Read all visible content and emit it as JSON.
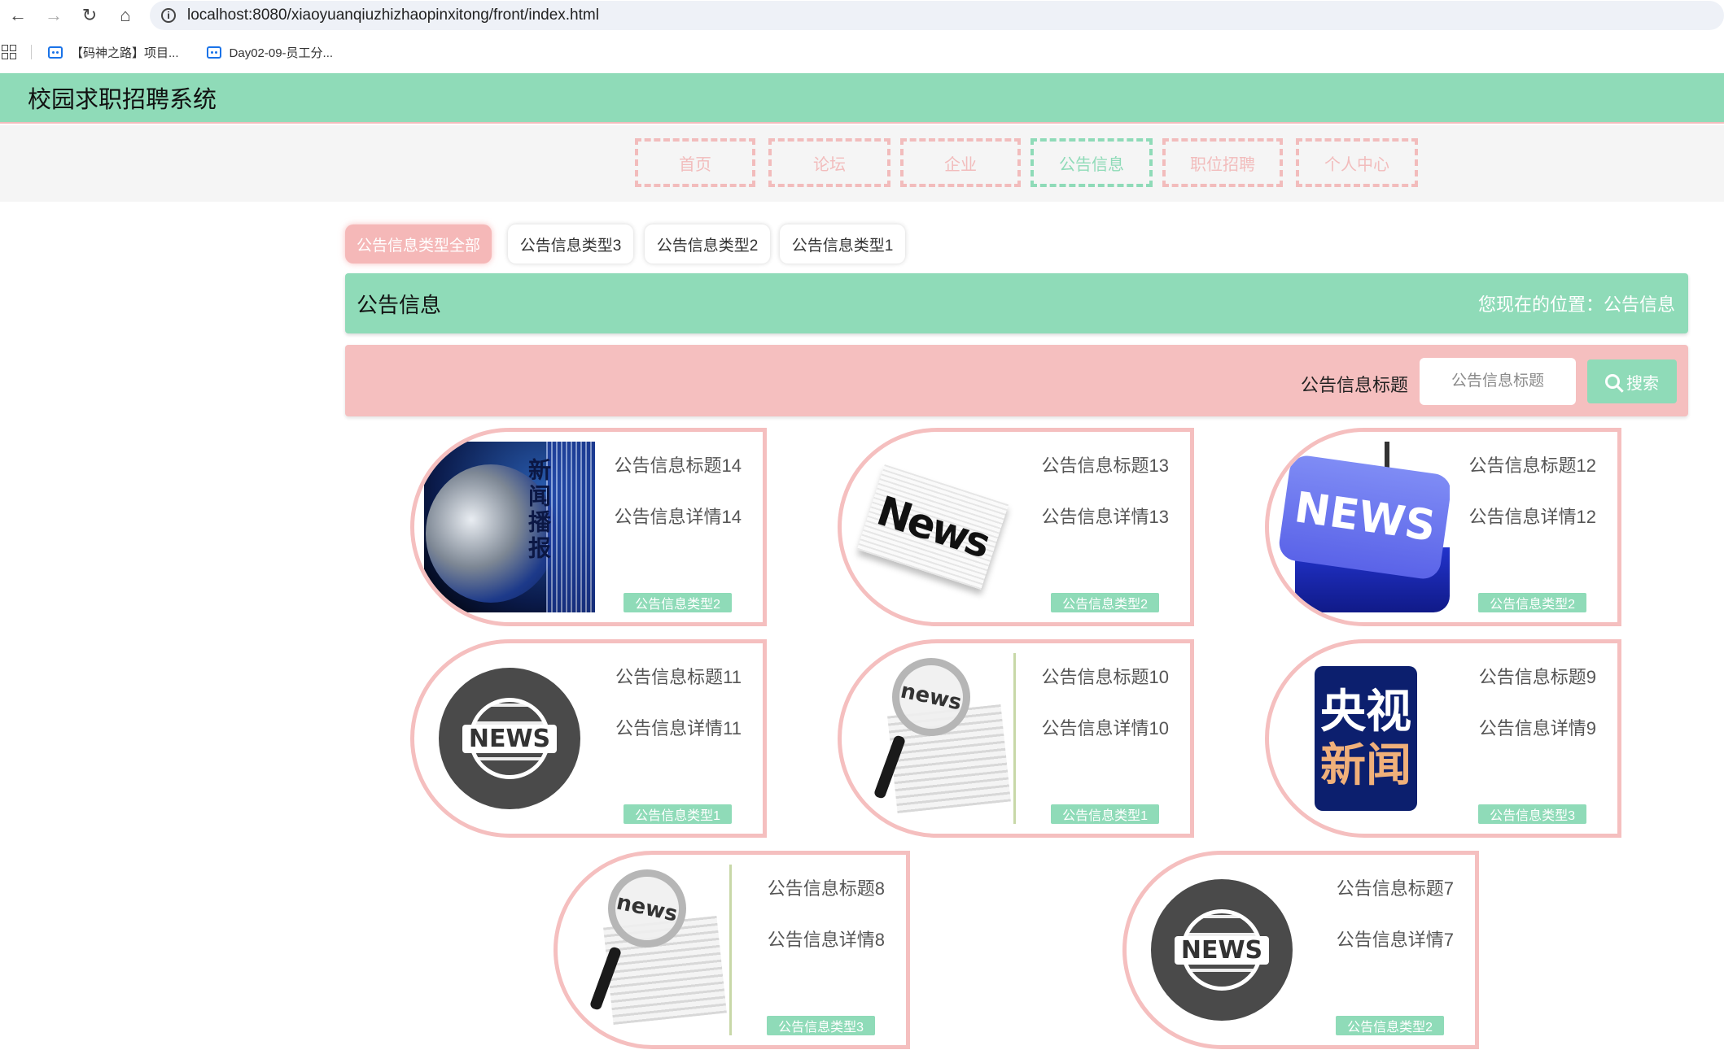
{
  "browser": {
    "url": "localhost:8080/xiaoyuanqiuzhizhaopinxitong/front/index.html",
    "bookmarks": [
      "【码神之路】项目...",
      "Day02-09-员工分..."
    ]
  },
  "app": {
    "title": "校园求职招聘系统"
  },
  "nav": {
    "items": [
      {
        "label": "首页"
      },
      {
        "label": "论坛"
      },
      {
        "label": "企业"
      },
      {
        "label": "公告信息"
      },
      {
        "label": "职位招聘"
      },
      {
        "label": "个人中心"
      }
    ],
    "active": "公告信息"
  },
  "types": {
    "items": [
      {
        "label": "公告信息类型全部"
      },
      {
        "label": "公告信息类型3"
      },
      {
        "label": "公告信息类型2"
      },
      {
        "label": "公告信息类型1"
      }
    ],
    "active": "公告信息类型全部"
  },
  "section": {
    "title": "公告信息",
    "breadcrumb": "您现在的位置：公告信息"
  },
  "search": {
    "label": "公告信息标题",
    "placeholder": "公告信息标题",
    "button": "搜索"
  },
  "cards": [
    {
      "title": "公告信息标题14",
      "detail": "公告信息详情14",
      "type": "公告信息类型2",
      "thumb": "globe-news"
    },
    {
      "title": "公告信息标题13",
      "detail": "公告信息详情13",
      "type": "公告信息类型2",
      "thumb": "newspaper"
    },
    {
      "title": "公告信息标题12",
      "detail": "公告信息详情12",
      "type": "公告信息类型2",
      "thumb": "news-key"
    },
    {
      "title": "公告信息标题11",
      "detail": "公告信息详情11",
      "type": "公告信息类型1",
      "thumb": "news-circle"
    },
    {
      "title": "公告信息标题10",
      "detail": "公告信息详情10",
      "type": "公告信息类型1",
      "thumb": "magnifier-news"
    },
    {
      "title": "公告信息标题9",
      "detail": "公告信息详情9",
      "type": "公告信息类型3",
      "thumb": "cctv-news"
    },
    {
      "title": "公告信息标题8",
      "detail": "公告信息详情8",
      "type": "公告信息类型3",
      "thumb": "magnifier-news"
    },
    {
      "title": "公告信息标题7",
      "detail": "公告信息详情7",
      "type": "公告信息类型2",
      "thumb": "news-circle"
    }
  ],
  "thumb_text": {
    "globe": "新闻播报",
    "paper": "News",
    "key": "NEWS",
    "circle": "NEWS",
    "mag": "news",
    "cctv_line1": "央视",
    "cctv_line2": "新闻"
  },
  "colors": {
    "primary": "#8fdbb8",
    "accent": "#f5bfbf"
  }
}
